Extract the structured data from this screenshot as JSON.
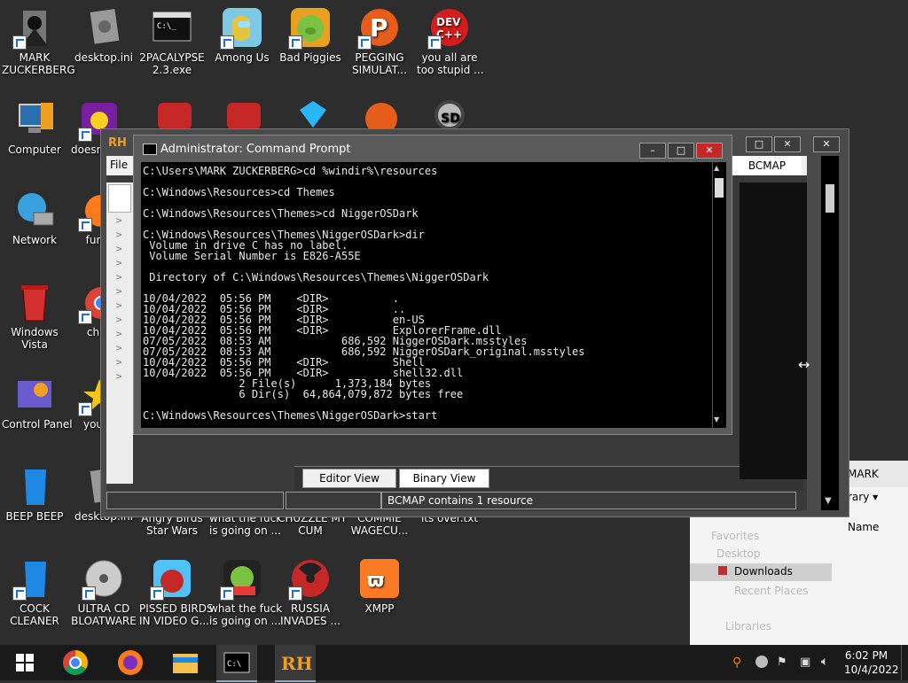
{
  "desktop": {
    "icons": [
      {
        "label": "MARK\nZUCKERBERG",
        "icon": "user-folder-icon"
      },
      {
        "label": "desktop.ini",
        "icon": "settings-file-icon"
      },
      {
        "label": "2PACALYPSE\n2.3.exe",
        "icon": "cmd-exe-icon"
      },
      {
        "label": "Among Us",
        "icon": "among-us-icon"
      },
      {
        "label": "Bad Piggies",
        "icon": "bad-piggies-icon"
      },
      {
        "label": "PEGGING\nSIMULAT...",
        "icon": "pegging-icon"
      },
      {
        "label": "you all are\ntoo stupid ...",
        "icon": "dev-cpp-icon"
      },
      {
        "label": "Computer",
        "icon": "computer-icon"
      },
      {
        "label": "doesn",
        "icon": "yahoo-icon"
      },
      {
        "label": "Network",
        "icon": "network-icon"
      },
      {
        "label": "fur",
        "icon": "firefox-icon"
      },
      {
        "label": "Windows\nVista",
        "icon": "recycle-bin-icon"
      },
      {
        "label": "ch",
        "icon": "chrome-icon"
      },
      {
        "label": "Control Panel",
        "icon": "control-panel-icon"
      },
      {
        "label": "you",
        "icon": "star-icon"
      },
      {
        "label": "BEEP BEEP",
        "icon": "blue-bin-icon"
      },
      {
        "label": "desktop.ini",
        "icon": "settings-file-icon"
      },
      {
        "label": "Angry Birds\nStar Wars",
        "icon": "angry-birds-icon"
      },
      {
        "label": "what the fuck\nis going on ...",
        "icon": "angry-birds-icon"
      },
      {
        "label": "CHUZZLE MY\nCUM",
        "icon": "chuzzle-icon"
      },
      {
        "label": "COMMIE\nWAGECU...",
        "icon": "commie-icon"
      },
      {
        "label": "its over.txt",
        "icon": "text-file-icon"
      },
      {
        "label": "COCK\nCLEANER",
        "icon": "blue-bin-icon"
      },
      {
        "label": "ULTRA CD\nBLOATWARE",
        "icon": "cd-icon"
      },
      {
        "label": "PISSED BIRDS\nIN VIDEO G...",
        "icon": "angry-birds-icon"
      },
      {
        "label": "what the fuck\nis going on ...",
        "icon": "angry-birds-pigs-icon"
      },
      {
        "label": "RUSSIA\nINVADES ...",
        "icon": "radiation-icon"
      },
      {
        "label": "XMPP",
        "icon": "xampp-icon"
      }
    ]
  },
  "resource_hacker": {
    "logo": "RH",
    "menu_file": "File",
    "right_label": "BCMAP",
    "tabs": [
      "Editor View",
      "Binary View"
    ],
    "status": "BCMAP contains 1 resource"
  },
  "cmd": {
    "title": "Administrator: Command Prompt",
    "lines": [
      "C:\\Users\\MARK ZUCKERBERG>cd %windir%\\resources",
      "",
      "C:\\Windows\\Resources>cd Themes",
      "",
      "C:\\Windows\\Resources\\Themes>cd NiggerOSDark",
      "",
      "C:\\Windows\\Resources\\Themes\\NiggerOSDark>dir",
      " Volume in drive C has no label.",
      " Volume Serial Number is E826-A55E",
      "",
      " Directory of C:\\Windows\\Resources\\Themes\\NiggerOSDark",
      "",
      "10/04/2022  05:56 PM    <DIR>          .",
      "10/04/2022  05:56 PM    <DIR>          ..",
      "10/04/2022  05:56 PM    <DIR>          en-US",
      "10/04/2022  05:56 PM    <DIR>          ExplorerFrame.dll",
      "07/05/2022  08:53 AM           686,592 NiggerOSDark.msstyles",
      "07/05/2022  08:53 AM           686,592 NiggerOSDark_original.msstyles",
      "10/04/2022  05:56 PM    <DIR>          Shell",
      "10/04/2022  05:56 PM    <DIR>          shell32.dll",
      "               2 File(s)      1,373,184 bytes",
      "               6 Dir(s)  64,864,079,872 bytes free",
      "",
      "C:\\Windows\\Resources\\Themes\\NiggerOSDark>start"
    ]
  },
  "explorer": {
    "title": "MARK ZUCKE",
    "library": "rary",
    "col_name": "Name",
    "nav": [
      "Favorites",
      "Desktop",
      "Downloads",
      "Recent Places",
      "Libraries"
    ],
    "selected": "Downloads"
  },
  "taskbar": {
    "apps": [
      "windows-start-icon",
      "chrome-icon",
      "firefox-icon",
      "file-explorer-icon",
      "cmd-icon",
      "resource-hacker-icon"
    ],
    "time": "6:02 PM",
    "date": "10/4/2022"
  }
}
